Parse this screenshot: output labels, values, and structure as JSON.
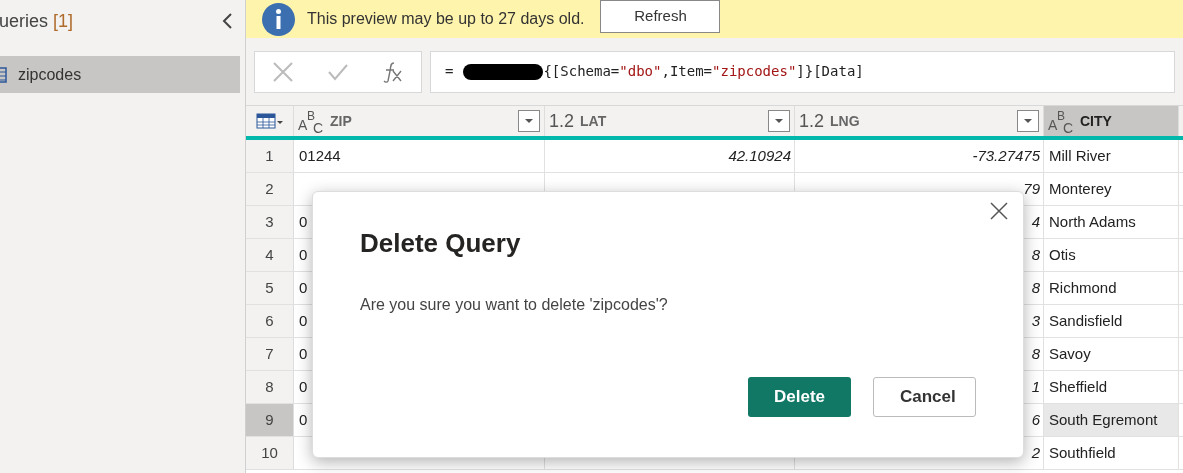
{
  "queries_panel": {
    "title": "ueries",
    "count": "[1]",
    "items": [
      {
        "label": "zipcodes",
        "selected": true
      }
    ]
  },
  "banner": {
    "message": "This preview may be up to 27 days old.",
    "button": "Refresh"
  },
  "formula_bar": {
    "prefix": "=",
    "formula_start": "{[Schema=",
    "schema": "\"dbo\"",
    "middle": ",Item=",
    "item": "\"zipcodes\"",
    "formula_end": "]}[Data]"
  },
  "table": {
    "columns": [
      {
        "type": "ABC",
        "name": "ZIP",
        "selected": false
      },
      {
        "type": "1.2",
        "name": "LAT",
        "selected": false
      },
      {
        "type": "1.2",
        "name": "LNG",
        "selected": false
      },
      {
        "type": "ABC",
        "name": "CITY",
        "selected": true
      }
    ],
    "rows": [
      {
        "num": "1",
        "selected": false,
        "cells": [
          "01244",
          "42.10924",
          "-73.27475",
          "Mill River"
        ]
      },
      {
        "num": "2",
        "selected": false,
        "cells": [
          null,
          null,
          "79",
          "Monterey"
        ]
      },
      {
        "num": "3",
        "selected": false,
        "cells": [
          "0",
          null,
          "4",
          "North Adams"
        ]
      },
      {
        "num": "4",
        "selected": false,
        "cells": [
          "0",
          null,
          "8",
          "Otis"
        ]
      },
      {
        "num": "5",
        "selected": false,
        "cells": [
          "0",
          null,
          "8",
          "Richmond"
        ]
      },
      {
        "num": "6",
        "selected": false,
        "cells": [
          "0",
          null,
          "3",
          "Sandisfield"
        ]
      },
      {
        "num": "7",
        "selected": false,
        "cells": [
          "0",
          null,
          "8",
          "Savoy"
        ]
      },
      {
        "num": "8",
        "selected": false,
        "cells": [
          "0",
          null,
          "1",
          "Sheffield"
        ]
      },
      {
        "num": "9",
        "selected": true,
        "cells": [
          "0",
          null,
          "6",
          "South Egremont"
        ]
      },
      {
        "num": "10",
        "selected": false,
        "cells": [
          null,
          null,
          "2",
          "Southfield"
        ]
      }
    ]
  },
  "dialog": {
    "title": "Delete Query",
    "message": "Are you sure you want to delete 'zipcodes'?",
    "buttons": [
      {
        "label": "Delete",
        "kind": "primary"
      },
      {
        "label": "Cancel",
        "kind": "secondary"
      }
    ]
  }
}
